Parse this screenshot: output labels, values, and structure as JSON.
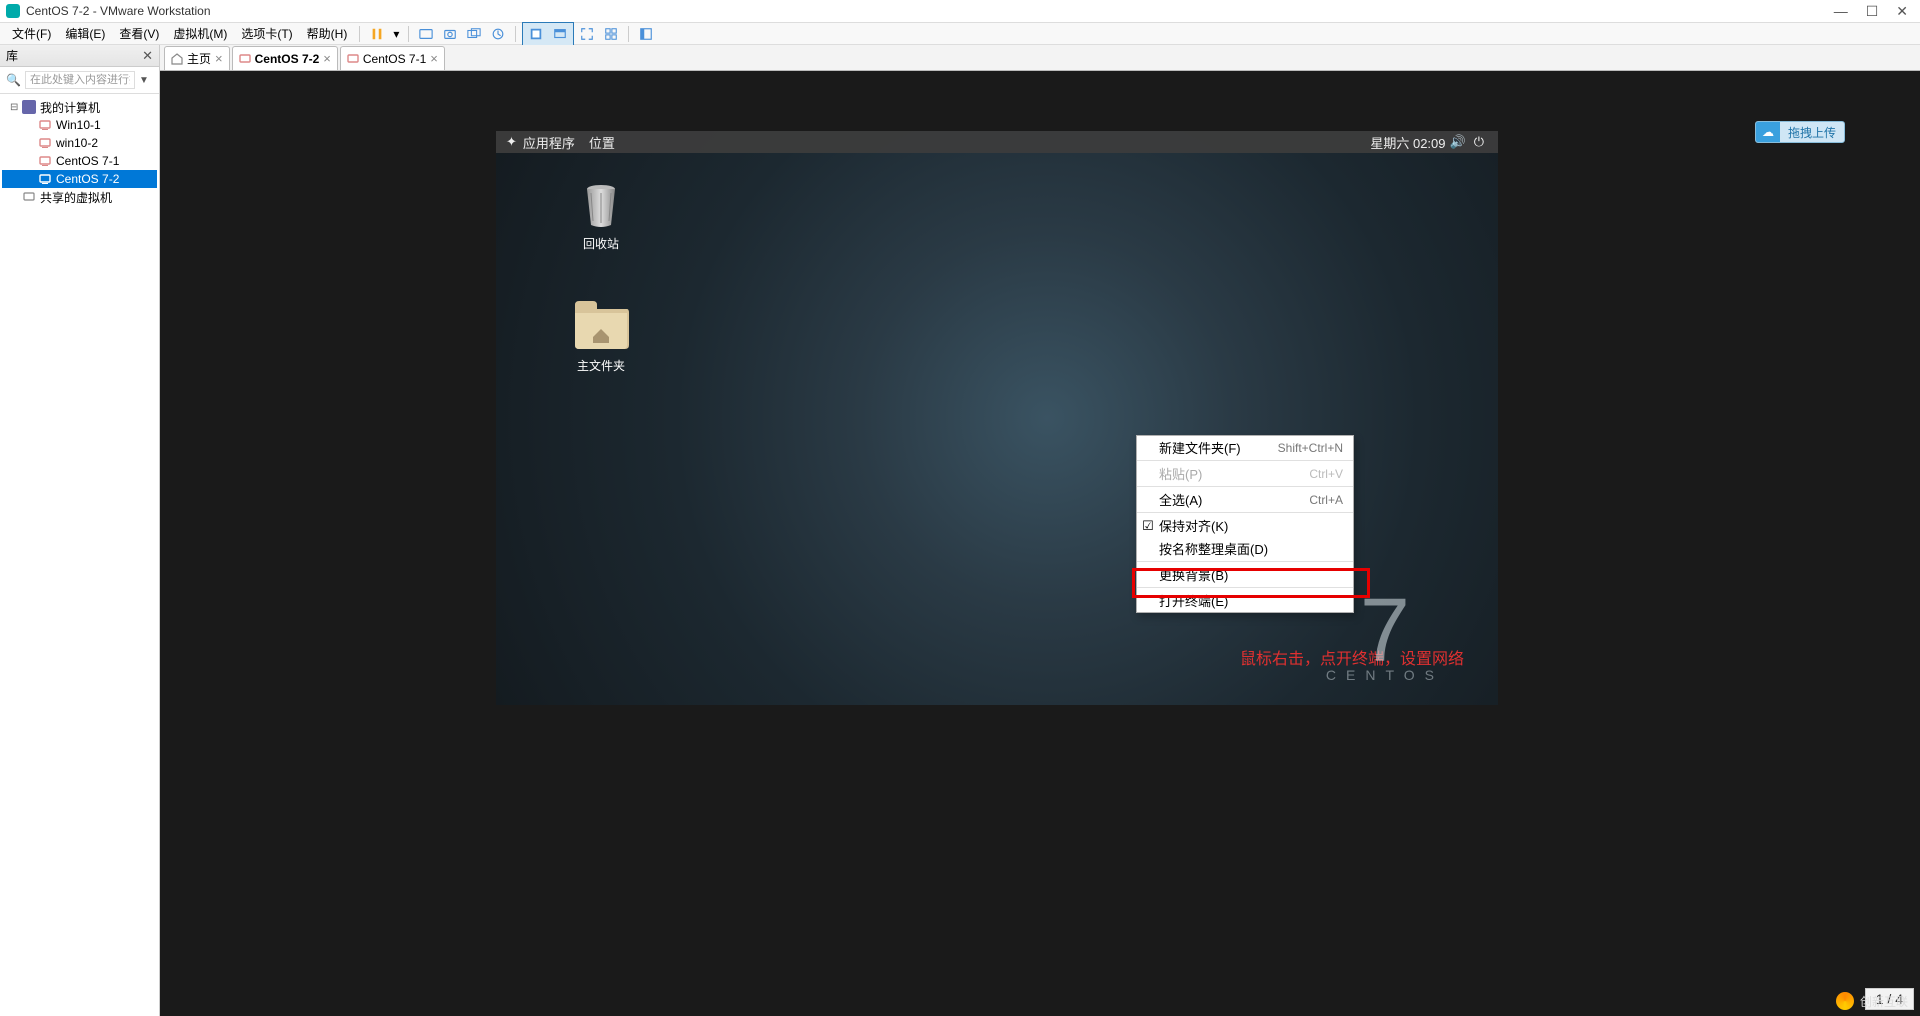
{
  "title": "CentOS 7-2 - VMware Workstation",
  "menu": {
    "file": "文件(F)",
    "edit": "编辑(E)",
    "view": "查看(V)",
    "vm": "虚拟机(M)",
    "tabs": "选项卡(T)",
    "help": "帮助(H)"
  },
  "library": {
    "header": "库",
    "search_placeholder": "在此处键入内容进行搜索",
    "root": "我的计算机",
    "items": [
      {
        "name": "Win10-1"
      },
      {
        "name": "win10-2"
      },
      {
        "name": "CentOS 7-1"
      },
      {
        "name": "CentOS 7-2"
      }
    ],
    "shared": "共享的虚拟机"
  },
  "tabs": [
    {
      "label": "主页"
    },
    {
      "label": "CentOS 7-2"
    },
    {
      "label": "CentOS 7-1"
    }
  ],
  "centos": {
    "apps": "应用程序",
    "places": "位置",
    "clock": "星期六 02:09",
    "trash": "回收站",
    "home": "主文件夹",
    "mark_num": "7",
    "mark_label": "CENTOS"
  },
  "ctx": {
    "new_folder": "新建文件夹(F)",
    "new_folder_sc": "Shift+Ctrl+N",
    "paste": "粘贴(P)",
    "paste_sc": "Ctrl+V",
    "select_all": "全选(A)",
    "select_all_sc": "Ctrl+A",
    "keep_aligned": "保持对齐(K)",
    "organize": "按名称整理桌面(D)",
    "change_bg": "更换背景(B)",
    "open_terminal": "打开终端(E)"
  },
  "annotation": "鼠标右击，点开终端，设置网络",
  "page_indicator": "1 / 4",
  "cloud_upload": "拖拽上传",
  "brand": "创新互联"
}
